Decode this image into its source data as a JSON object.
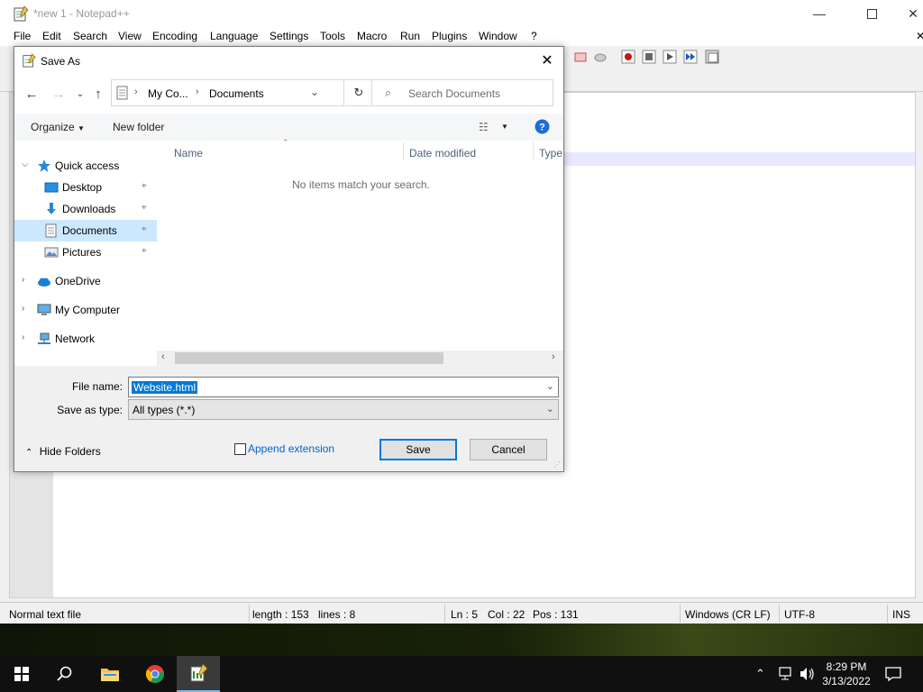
{
  "npp": {
    "title": "*new 1 - Notepad++",
    "menu": [
      "File",
      "Edit",
      "Search",
      "View",
      "Encoding",
      "Language",
      "Settings",
      "Tools",
      "Macro",
      "Run",
      "Plugins",
      "Window",
      "?"
    ],
    "status": {
      "file_type": "Normal text file",
      "length": "length : 153",
      "lines": "lines : 8",
      "ln": "Ln : 5",
      "col": "Col : 22",
      "pos": "Pos : 131",
      "eol": "Windows (CR LF)",
      "encoding": "UTF-8",
      "mode": "INS"
    }
  },
  "dialog": {
    "title": "Save As",
    "address": [
      "My Co...",
      "Documents"
    ],
    "search_placeholder": "Search Documents",
    "organize": "Organize",
    "new_folder": "New folder",
    "nav": {
      "quick_access": "Quick access",
      "items": [
        "Desktop",
        "Downloads",
        "Documents",
        "Pictures"
      ],
      "onedrive": "OneDrive",
      "my_computer": "My Computer",
      "network": "Network"
    },
    "columns": [
      "Name",
      "Date modified",
      "Type"
    ],
    "empty_message": "No items match your search.",
    "file_name_label": "File name:",
    "file_name": "Website.html",
    "save_type_label": "Save as type:",
    "save_type": "All types (*.*)",
    "hide_folders": "Hide Folders",
    "append_extension": "Append extension",
    "save": "Save",
    "cancel": "Cancel"
  },
  "taskbar": {
    "time": "8:29 PM",
    "date": "3/13/2022"
  }
}
